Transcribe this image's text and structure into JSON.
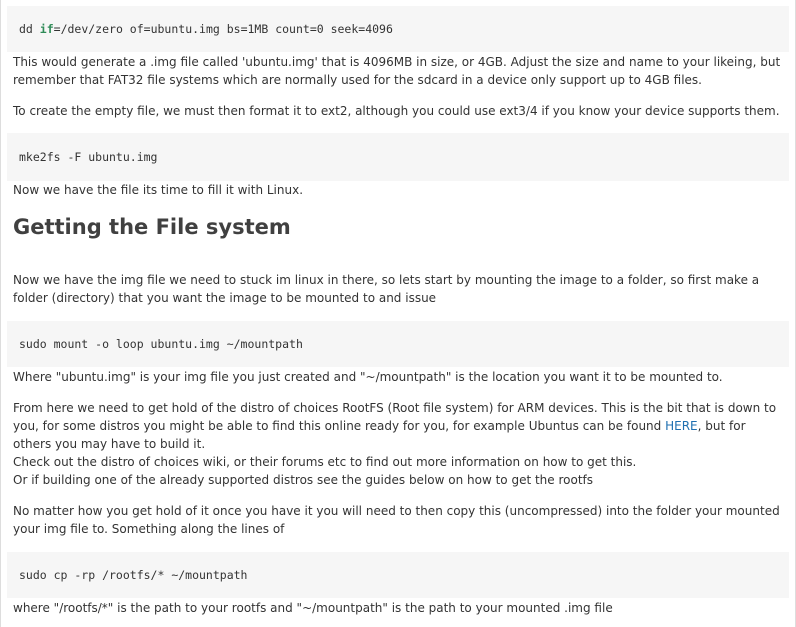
{
  "code1": {
    "prefix": "dd ",
    "keyword": "if",
    "rest": "=/dev/zero of=ubuntu.img bs=1MB count=0 seek=4096"
  },
  "para1": "This would generate a .img file called 'ubuntu.img' that is 4096MB in size, or 4GB. Adjust the size and name to your likeing, but remember that FAT32 file systems which are normally used for the sdcard in a device only support up to 4GB files.",
  "para2": "To create the empty file, we must then format it to ext2, although you could use ext3/4 if you know your device supports them.",
  "code2": "mke2fs -F ubuntu.img",
  "para3": "Now we have the file its time to fill it with Linux.",
  "heading": "Getting the File system",
  "para4": "Now we have the img file we need to stuck im linux in there, so lets start by mounting the image to a folder, so first make a folder (directory) that you want the image to be mounted to and issue",
  "code3": "sudo mount -o loop ubuntu.img ~/mountpath",
  "para5": "Where \"ubuntu.img\" is your img file you just created and \"~/mountpath\" is the location you want it to be mounted to.",
  "para6": {
    "text_before_link": "From here we need to get hold of the distro of choices RootFS (Root file system) for ARM devices. This is the bit that is down to you, for some distros you might be able to find this online ready for you, for example Ubuntus can be found ",
    "link_text": "HERE",
    "text_after_link": ", but for others you may have to build it.",
    "line2": "Check out the distro of choices wiki, or their forums etc to find out more information on how to get this.",
    "line3": "Or if building one of the already supported distros see the guides below on how to get the rootfs"
  },
  "para7": "No matter how you get hold of it once you have it you will need to then copy this (uncompressed) into the folder your mounted your img file to. Something along the lines of",
  "code4": "sudo cp -rp /rootfs/* ~/mountpath",
  "para8": "where \"/rootfs/*\" is the path to your rootfs and \"~/mountpath\" is the path to your mounted .img file",
  "colors": {
    "code_bg": "#f6f6f6",
    "keyword": "#2e8b57",
    "link": "#1e6fb0",
    "text": "#333333"
  }
}
